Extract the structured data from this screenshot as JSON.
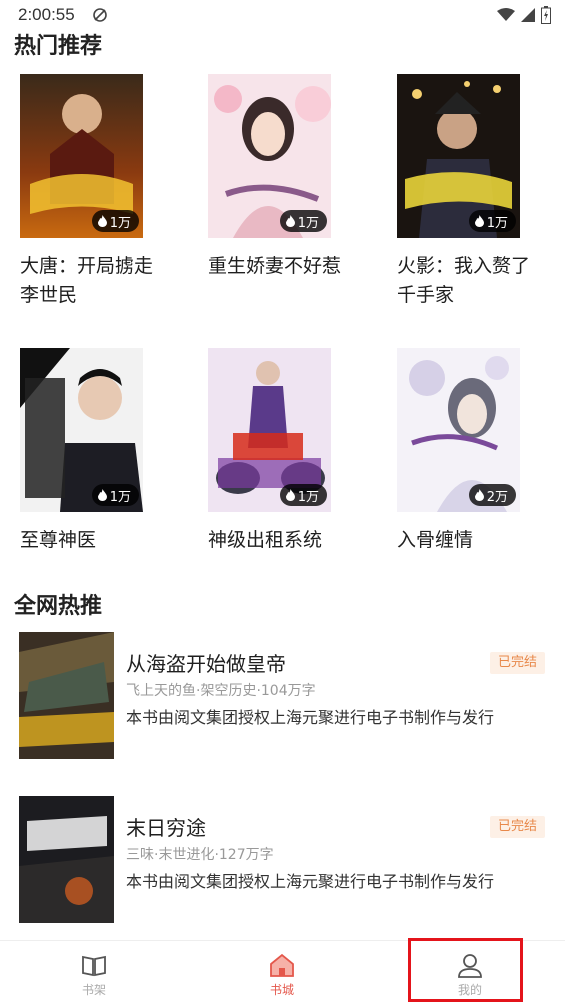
{
  "status_bar": {
    "time": "2:00:55",
    "icons": [
      "app-notification-icon",
      "wifi-icon",
      "signal-icon",
      "battery-icon"
    ]
  },
  "sections": {
    "hot": "热门推荐",
    "network": "全网热推"
  },
  "hot_books": [
    {
      "title": "大唐：开局掳走李世民",
      "heat": "1万"
    },
    {
      "title": "重生娇妻不好惹",
      "heat": "1万"
    },
    {
      "title": "火影：我入赘了千手家",
      "heat": "1万"
    },
    {
      "title": "至尊神医",
      "heat": "1万"
    },
    {
      "title": "神级出租系统",
      "heat": "1万"
    },
    {
      "title": "入骨缠情",
      "heat": "2万"
    }
  ],
  "network_books": [
    {
      "title": "从海盗开始做皇帝",
      "status": "已完结",
      "meta": "飞上天的鱼·架空历史·104万字",
      "desc": "本书由阅文集团授权上海元聚进行电子书制作与发行"
    },
    {
      "title": "末日穷途",
      "status": "已完结",
      "meta": "三味·末世进化·127万字",
      "desc": "本书由阅文集团授权上海元聚进行电子书制作与发行"
    }
  ],
  "tabbar": {
    "shelf": "书架",
    "store": "书城",
    "mine": "我的",
    "active": "书城",
    "accent": "#e4574b"
  }
}
